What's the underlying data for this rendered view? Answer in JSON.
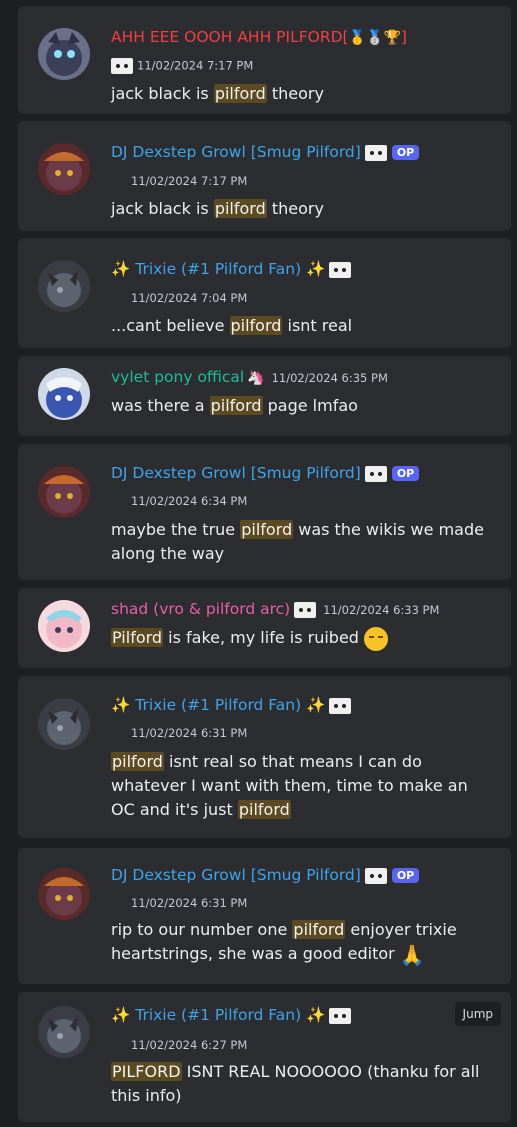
{
  "messages": [
    {
      "author": "AHH EEE OOOH AHH PILFORD[",
      "author_suffix": "]",
      "name_color": "#f23f42",
      "timestamp": "11/02/2024 7:17 PM",
      "body": [
        "jack black is ",
        "pilford",
        " theory"
      ]
    },
    {
      "author": "DJ Dexstep Growl [Smug Pilford]",
      "name_color": "#3ea4ea",
      "badge": "OP",
      "timestamp": "11/02/2024 7:17 PM",
      "body": [
        "jack black is ",
        "pilford",
        " theory"
      ]
    },
    {
      "author": "Trixie (#1 Pilford Fan)",
      "name_color": "#3ea4ea",
      "timestamp": "11/02/2024 7:04 PM",
      "body": [
        "...cant believe ",
        "pilford",
        " isnt real"
      ]
    },
    {
      "author": "vylet pony offical",
      "name_color": "#1abc9c",
      "timestamp": "11/02/2024 6:35 PM",
      "body": [
        "was there a ",
        "pilford",
        " page lmfao"
      ]
    },
    {
      "author": "DJ Dexstep Growl [Smug Pilford]",
      "name_color": "#3ea4ea",
      "badge": "OP",
      "timestamp": "11/02/2024 6:34 PM",
      "body": [
        "maybe the true ",
        "pilford",
        " was the wikis we made along the way"
      ]
    },
    {
      "author": "shad (vro & pilford arc)",
      "name_color": "#e85ea8",
      "timestamp": "11/02/2024 6:33 PM",
      "body": [
        "",
        "Pilford",
        " is fake, my life is ruibed "
      ]
    },
    {
      "author": "Trixie (#1 Pilford Fan)",
      "name_color": "#3ea4ea",
      "timestamp": "11/02/2024 6:31 PM",
      "body": [
        "",
        "pilford",
        " isnt real so that means I can do whatever I want with them, time to make an OC and it's just ",
        "pilford",
        ""
      ]
    },
    {
      "author": "DJ Dexstep Growl [Smug Pilford]",
      "name_color": "#3ea4ea",
      "badge": "OP",
      "timestamp": "11/02/2024 6:31 PM",
      "body": [
        "rip to our number one ",
        "pilford",
        " enjoyer trixie heartstrings, she was a good editor "
      ]
    },
    {
      "author": "Trixie (#1 Pilford Fan)",
      "name_color": "#3ea4ea",
      "timestamp": "11/02/2024 6:27 PM",
      "body": [
        "",
        "PILFORD",
        " ISNT REAL NOOOOOO (thanku for all this info)"
      ],
      "jump_label": "Jump"
    }
  ]
}
